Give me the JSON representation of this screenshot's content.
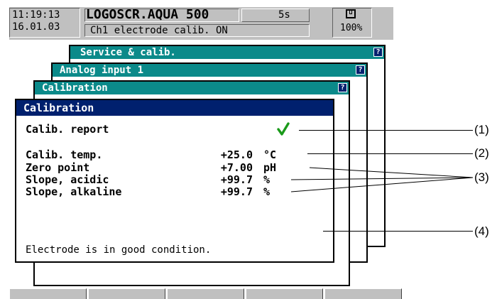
{
  "status": {
    "time": "11:19:13",
    "date": "16.01.03",
    "device": "LOGOSCR.AQUA 500",
    "interval": "5s",
    "message": "Ch1 electrode calib. ON",
    "memory": "100%"
  },
  "windows": [
    {
      "title": "Service & calib.",
      "help": "?"
    },
    {
      "title": "Analog input 1",
      "help": "?"
    },
    {
      "title": "Calibration",
      "help": "?"
    }
  ],
  "dialog": {
    "title": "Calibration",
    "report_label": "Calib. report",
    "rows": [
      {
        "label": "Calib. temp.",
        "value": "+25.0",
        "unit": "°C"
      },
      {
        "label": "Zero point",
        "value": "+7.00",
        "unit": "pH"
      },
      {
        "label": "Slope, acidic",
        "value": "+99.7",
        "unit": "%"
      },
      {
        "label": "Slope, alkaline",
        "value": "+99.7",
        "unit": "%"
      }
    ],
    "message": "Electrode is in good condition."
  },
  "callouts": [
    "(1)",
    "(2)",
    "(3)",
    "(4)"
  ],
  "colors": {
    "teal_title": "#0b8a8a",
    "navy_title": "#00206e",
    "check": "#1a9a1a"
  }
}
